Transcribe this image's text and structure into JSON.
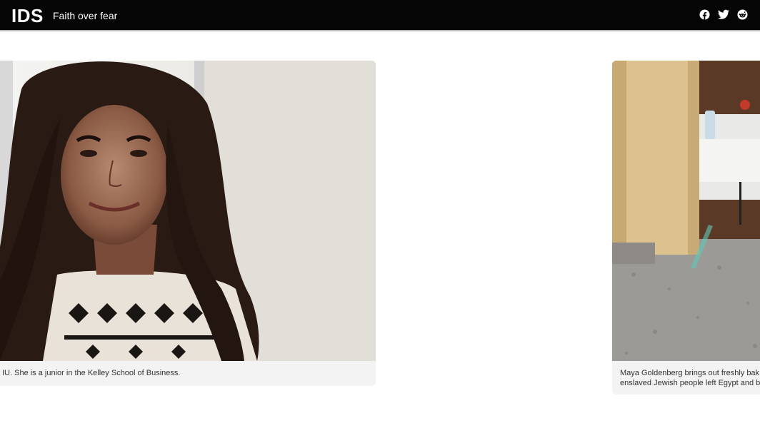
{
  "header": {
    "logo": "IDS",
    "title": "Faith over fear",
    "social": [
      {
        "icon": "facebook-icon",
        "label": "Facebook"
      },
      {
        "icon": "twitter-icon",
        "label": "Twitter"
      },
      {
        "icon": "reddit-icon",
        "label": "Reddit"
      }
    ]
  },
  "gallery": {
    "slides": [
      {
        "caption": "IU. She is a junior in the Kelley School of Business."
      },
      {
        "caption_line1": "Maya Goldenberg brings out freshly bak",
        "caption_line2": "enslaved Jewish people left Egypt and b"
      }
    ]
  },
  "colors": {
    "header_bg": "#050505",
    "caption_bg": "#f3f3f3"
  }
}
